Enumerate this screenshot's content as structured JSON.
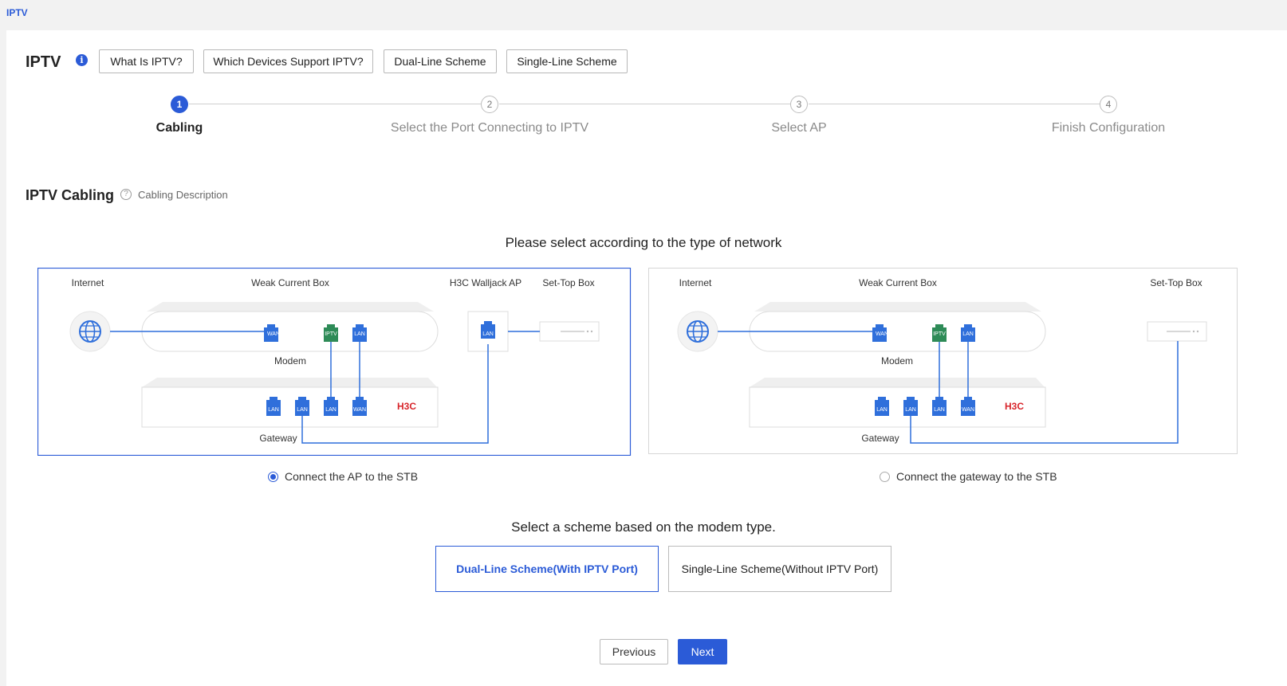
{
  "breadcrumb": "IPTV",
  "header": {
    "title": "IPTV",
    "buttons": [
      "What Is IPTV?",
      "Which Devices Support IPTV?",
      "Dual-Line Scheme",
      "Single-Line Scheme"
    ]
  },
  "steps": [
    {
      "number": "1",
      "label": "Cabling",
      "active": true
    },
    {
      "number": "2",
      "label": "Select the Port Connecting to IPTV",
      "active": false
    },
    {
      "number": "3",
      "label": "Select AP",
      "active": false
    },
    {
      "number": "4",
      "label": "Finish Configuration",
      "active": false
    }
  ],
  "section": {
    "title": "IPTV Cabling",
    "help": "Cabling Description"
  },
  "network_prompt": "Please select according to the type of network",
  "diagram_left": {
    "internet": "Internet",
    "weak_box": "Weak Current Box",
    "ap": "H3C Walljack AP",
    "stb": "Set-Top Box",
    "modem": "Modem",
    "gateway": "Gateway",
    "brand": "H3C",
    "port_wan": "WAN",
    "port_iptv": "IPTV",
    "port_lan": "LAN"
  },
  "diagram_right": {
    "internet": "Internet",
    "weak_box": "Weak Current Box",
    "stb": "Set-Top Box",
    "modem": "Modem",
    "gateway": "Gateway",
    "brand": "H3C",
    "port_wan": "WAN",
    "port_iptv": "IPTV",
    "port_lan": "LAN"
  },
  "network_options": [
    {
      "label": "Connect the AP to the STB",
      "checked": true
    },
    {
      "label": "Connect the gateway to the STB",
      "checked": false
    }
  ],
  "scheme_prompt": "Select a scheme based on the modem type.",
  "schemes": [
    {
      "label": "Dual-Line Scheme(With IPTV Port)",
      "selected": true
    },
    {
      "label": "Single-Line Scheme(Without IPTV Port)",
      "selected": false
    }
  ],
  "footer": {
    "previous": "Previous",
    "next": "Next"
  },
  "colors": {
    "accent": "#2b5bd7",
    "port_blue": "#2f6fdb",
    "port_green": "#2e8b57",
    "brand_red": "#d8262c"
  }
}
